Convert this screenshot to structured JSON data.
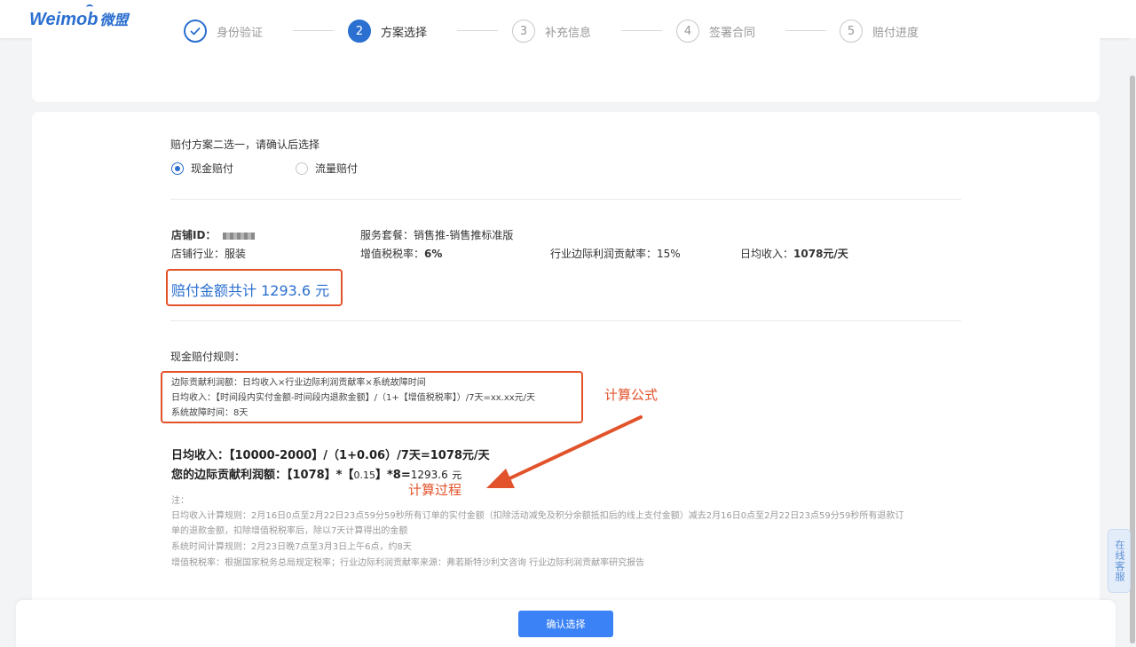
{
  "header": {
    "logo_text": "Weimob",
    "logo_cn": "微盟"
  },
  "steps": [
    {
      "number": "1",
      "label": "身份验证",
      "state": "done"
    },
    {
      "number": "2",
      "label": "方案选择",
      "state": "active"
    },
    {
      "number": "3",
      "label": "补充信息",
      "state": "pending"
    },
    {
      "number": "4",
      "label": "签署合同",
      "state": "pending"
    },
    {
      "number": "5",
      "label": "赔付进度",
      "state": "pending"
    }
  ],
  "plan": {
    "prompt": "赔付方案二选一，请确认后选择",
    "options": [
      {
        "label": "现金赔付",
        "selected": true
      },
      {
        "label": "流量赔付",
        "selected": false
      }
    ]
  },
  "store": {
    "id_label": "店铺ID：",
    "industry": "店铺行业：服装",
    "service_label": "服务套餐：",
    "service_value": "销售推-销售推标准版",
    "vat_label": "增值税税率：",
    "vat_value": "6%",
    "margin": "行业边际利润贡献率：15%",
    "daily_label": "日均收入：",
    "daily_value": "1078元/天"
  },
  "total": "赔付金额共计 1293.6 元",
  "rules": {
    "title": "现金赔付规则：",
    "lines": [
      "边际贡献利润额：日均收入×行业边际利润贡献率×系统故障时间",
      "日均收入：【时间段内实付金额-时间段内退款金额】/（1+【增值税税率】）/7天=xx.xx元/天",
      "系统故障时间：8天"
    ]
  },
  "annotations": {
    "formula": "计算公式",
    "process": "计算过程"
  },
  "calc": {
    "line1": "日均收入：【10000-2000】/（1+0.06）/7天=1078元/天",
    "line2_prefix": "您的边际贡献利润额：【1078】*【",
    "line2_rate": "0.15",
    "line2_mid": "】*8=",
    "line2_value": "1293.6",
    "line2_unit": "元"
  },
  "notes": [
    "注：",
    "日均收入计算规则：2月16日0点至2月22日23点59分59秒所有订单的实付金额（扣除活动减免及积分余额抵扣后的线上支付金额）减去2月16日0点至2月22日23点59分59秒所有退款订",
    "单的退款金额，扣除增值税税率后，除以7天计算得出的金额",
    "系统时间计算规则：2月23日晚7点至3月3日上午6点，约8天",
    "增值税税率：根据国家税务总局规定税率；行业边际利润贡献率来源：弗若斯特沙利文咨询 行业边际利润贡献率研究报告"
  ],
  "confirm_button": "确认选择",
  "side_service": "在线客服",
  "colors": {
    "primary": "#2b6fd0",
    "annotation": "#e2532b",
    "button": "#3b82f6"
  }
}
